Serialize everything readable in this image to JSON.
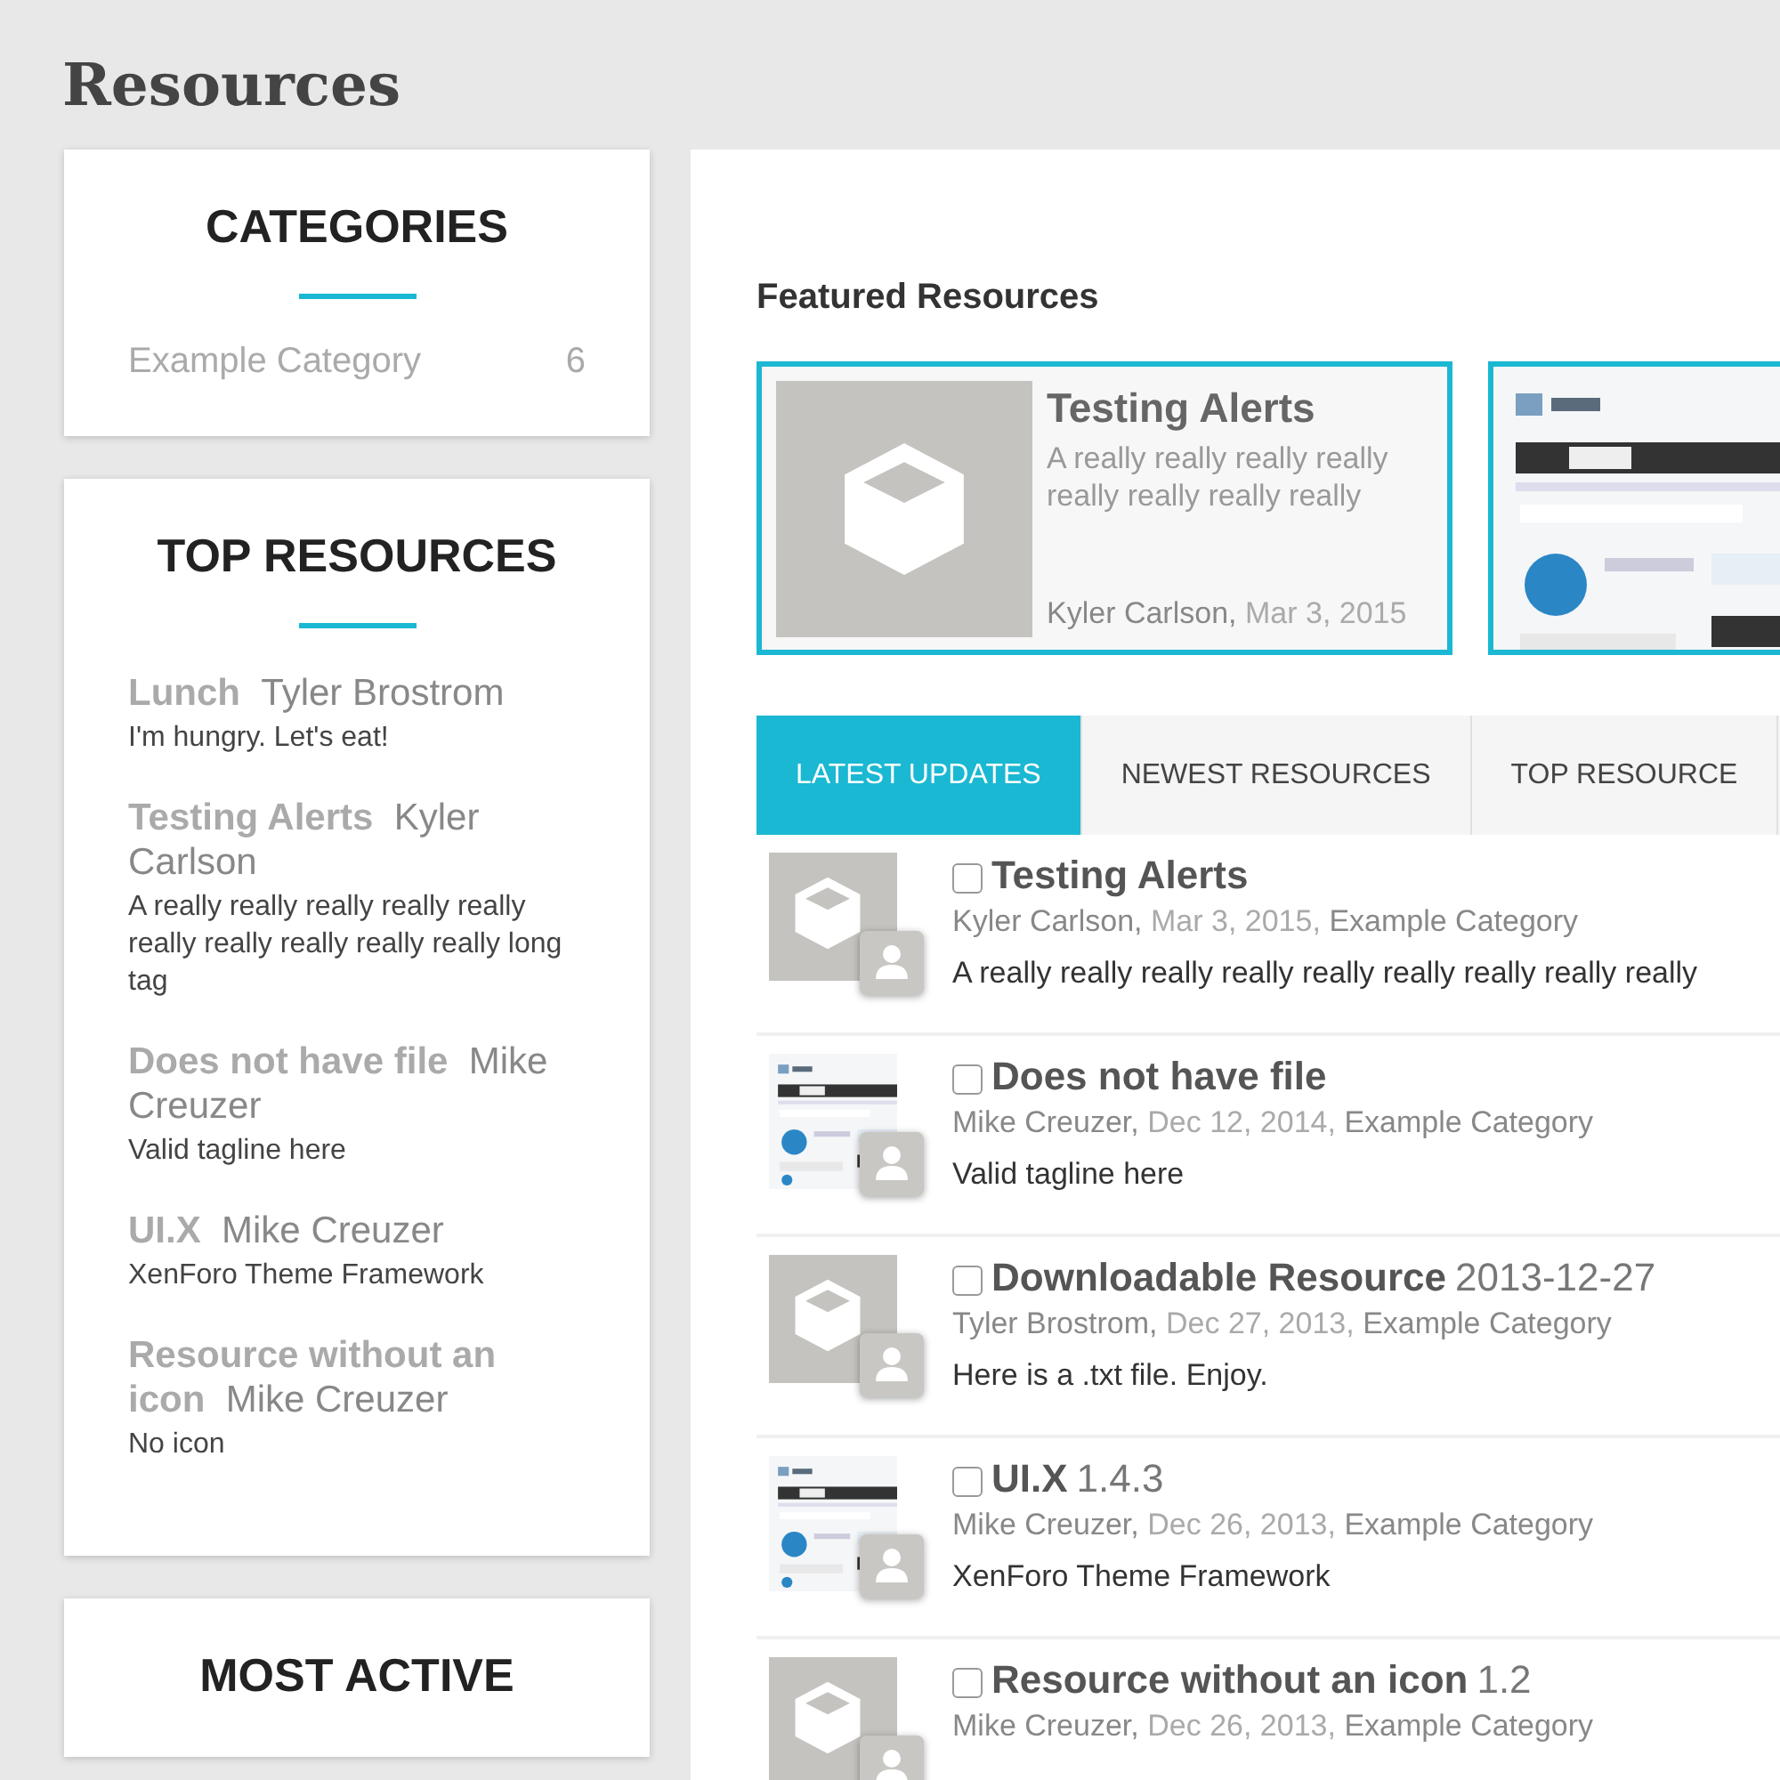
{
  "page_title": "Resources",
  "categories": {
    "heading": "CATEGORIES",
    "items": [
      {
        "name": "Example Category",
        "count": "6"
      }
    ]
  },
  "top_resources": {
    "heading": "TOP RESOURCES",
    "items": [
      {
        "title": "Lunch",
        "author": "Tyler Brostrom",
        "tagline": "I'm hungry. Let's eat!"
      },
      {
        "title": "Testing Alerts",
        "author": "Kyler Carlson",
        "tagline": "A really really really really really really really really really really long tag"
      },
      {
        "title": "Does not have file",
        "author": "Mike Creuzer",
        "tagline": "Valid tagline here"
      },
      {
        "title": "UI.X",
        "author": "Mike Creuzer",
        "tagline": "XenForo Theme Framework"
      },
      {
        "title": "Resource without an icon",
        "author": "Mike Creuzer",
        "tagline": "No icon"
      }
    ]
  },
  "most_active": {
    "heading": "MOST ACTIVE"
  },
  "featured": {
    "heading": "Featured Resources",
    "items": [
      {
        "kind": "resource",
        "title": "Testing Alerts",
        "description": "A really really really really really really really really",
        "author": "Kyler Carlson,",
        "date": "Mar 3, 2015"
      },
      {
        "kind": "picture"
      }
    ]
  },
  "tabs": [
    {
      "label": "LATEST UPDATES",
      "selected": true
    },
    {
      "label": "NEWEST RESOURCES",
      "selected": false
    },
    {
      "label": "TOP RESOURCE",
      "selected": false
    }
  ],
  "rows": [
    {
      "kind": "icon",
      "checked": false,
      "title": "Testing Alerts",
      "author": "Kyler Carlson,",
      "date": "Mar 3, 2015,",
      "category": "Example Category",
      "description": "A really really really really really really really really really"
    },
    {
      "kind": "picture",
      "checked": false,
      "title": "Does not have file",
      "author": "Mike Creuzer,",
      "date": "Dec 12, 2014,",
      "category": "Example Category",
      "description": "Valid tagline here"
    },
    {
      "kind": "icon",
      "checked": false,
      "title": "Downloadable Resource",
      "version": "2013-12-27",
      "author": "Tyler Brostrom,",
      "date": "Dec 27, 2013,",
      "category": "Example Category",
      "description": "Here is a .txt file. Enjoy."
    },
    {
      "kind": "picture",
      "checked": false,
      "title": "UI.X",
      "version": "1.4.3",
      "author": "Mike Creuzer,",
      "date": "Dec 26, 2013,",
      "category": "Example Category",
      "description": "XenForo Theme Framework"
    },
    {
      "kind": "icon",
      "checked": false,
      "title": "Resource without an icon",
      "version": "1.2",
      "author": "Mike Creuzer,",
      "date": "Dec 26, 2013,",
      "category": "Example Category"
    }
  ]
}
